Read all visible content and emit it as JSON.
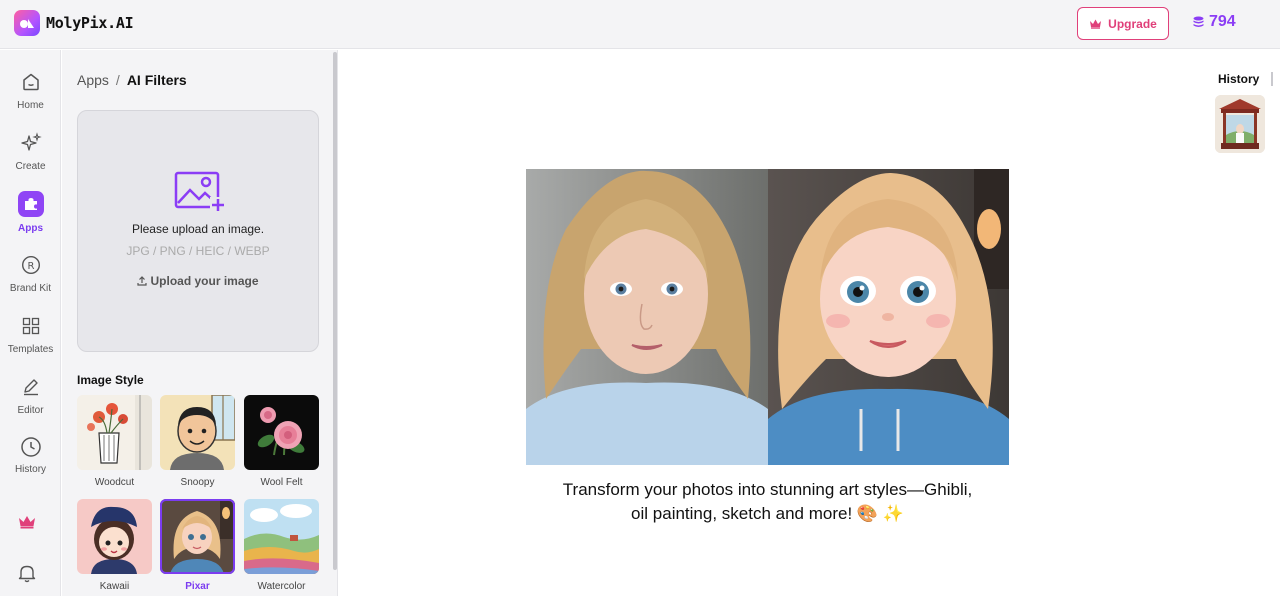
{
  "header": {
    "app_name": "MolyPix.AI",
    "upgrade_label": "Upgrade",
    "credits": "794",
    "accent_color": "#8b3df5",
    "upgrade_color": "#e0407a"
  },
  "nav": {
    "items": [
      {
        "label": "Home",
        "icon": "home-icon"
      },
      {
        "label": "Create",
        "icon": "sparkles-icon"
      },
      {
        "label": "Apps",
        "icon": "puzzle-icon",
        "active": true
      },
      {
        "label": "Brand Kit",
        "icon": "registered-icon"
      },
      {
        "label": "Templates",
        "icon": "grid-icon"
      },
      {
        "label": "Editor",
        "icon": "pencil-icon"
      },
      {
        "label": "History",
        "icon": "clock-icon"
      }
    ]
  },
  "panel": {
    "breadcrumb_parent": "Apps",
    "breadcrumb_sep": "/",
    "breadcrumb_current": "AI Filters",
    "upload_title": "Please upload an image.",
    "upload_formats": "JPG / PNG / HEIC / WEBP",
    "upload_button": "Upload your image",
    "style_section_title": "Image Style",
    "styles": [
      {
        "label": "Woodcut"
      },
      {
        "label": "Snoopy"
      },
      {
        "label": "Wool Felt"
      },
      {
        "label": "Kawaii"
      },
      {
        "label": "Pixar",
        "selected": true
      },
      {
        "label": "Watercolor"
      }
    ]
  },
  "main": {
    "caption": "Transform your photos into stunning art styles—Ghibli, oil painting, sketch and more! 🎨 ✨",
    "history_title": "History"
  }
}
